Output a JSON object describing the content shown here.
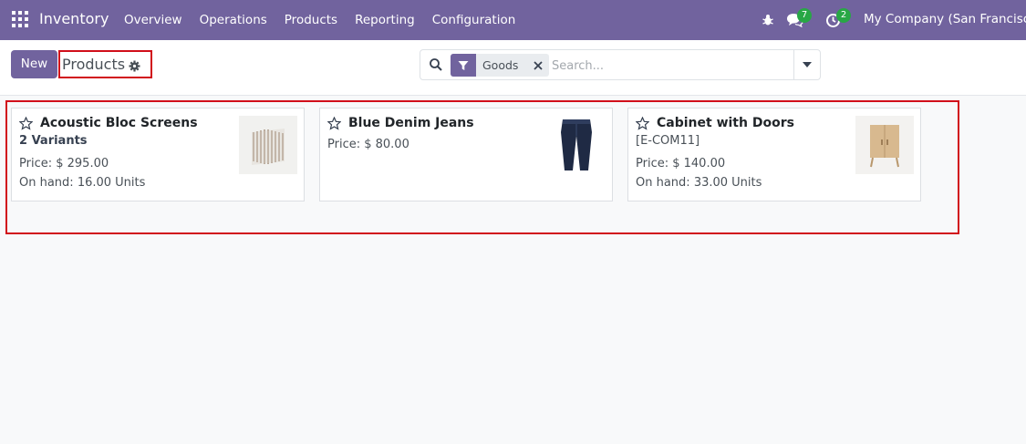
{
  "navbar": {
    "app_name": "Inventory",
    "menu": [
      "Overview",
      "Operations",
      "Products",
      "Reporting",
      "Configuration"
    ],
    "messages_count": "7",
    "activities_count": "2",
    "company": "My Company (San Francisco)"
  },
  "control": {
    "new_label": "New",
    "breadcrumb": "Products",
    "search_facet": "Goods",
    "search_placeholder": "Search..."
  },
  "products": [
    {
      "name": "Acoustic Bloc Screens",
      "variants": "2 Variants",
      "price": "Price: $ 295.00",
      "on_hand": "On hand: 16.00 Units",
      "image": "acoustic-screen"
    },
    {
      "name": "Blue Denim Jeans",
      "price": "Price: $ 80.00",
      "image": "jeans"
    },
    {
      "name": "Cabinet with Doors",
      "reference": "[E-COM11]",
      "price": "Price: $ 140.00",
      "on_hand": "On hand: 33.00 Units",
      "image": "cabinet"
    }
  ],
  "colors": {
    "brand": "#71639e",
    "badge": "#28a745",
    "highlight_border": "#d10f1a"
  }
}
